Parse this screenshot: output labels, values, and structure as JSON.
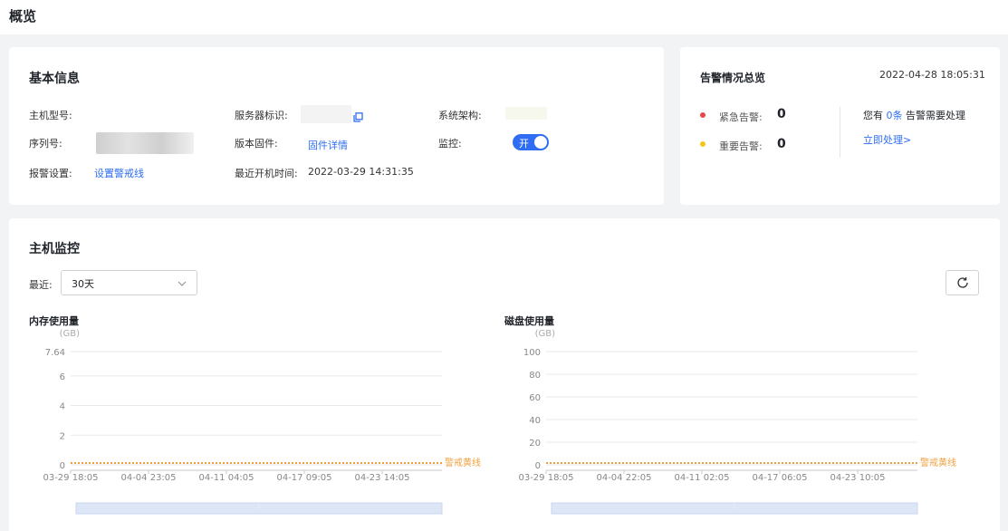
{
  "page": {
    "title": "概览"
  },
  "basic_info": {
    "title": "基本信息",
    "host_model_label": "主机型号:",
    "serial_label": "序列号:",
    "alarm_setting_label": "报警设置:",
    "alarm_setting_link": "设置警戒线",
    "server_id_label": "服务器标识:",
    "firmware_label": "版本固件:",
    "firmware_link": "固件详情",
    "last_boot_label": "最近开机时间:",
    "last_boot_value": "2022-03-29 14:31:35",
    "arch_label": "系统架构:",
    "monitor_label": "监控:",
    "monitor_toggle": "开"
  },
  "alarm_overview": {
    "title": "告警情况总览",
    "timestamp": "2022-04-28 18:05:31",
    "urgent_label": "紧急告警:",
    "urgent_count": "0",
    "important_label": "重要告警:",
    "important_count": "0",
    "pending_prefix": "您有",
    "pending_count": "0条",
    "pending_suffix": "告警需要处理",
    "handle_link": "立即处理>",
    "colors": {
      "urgent": "#e5484d",
      "important": "#f5c518",
      "link": "#2f6ef2"
    }
  },
  "host_monitor": {
    "title": "主机监控",
    "range_label": "最近:",
    "range_value": "30天"
  },
  "chart_data": [
    {
      "type": "line",
      "title": "内存使用量",
      "unit": "(GB)",
      "y_ticks": [
        "7.64",
        "6",
        "4",
        "2",
        "0"
      ],
      "ylim": [
        0,
        7.64
      ],
      "x_ticks": [
        "03-29 18:05",
        "04-04 23:05",
        "04-11 04:05",
        "04-17 09:05",
        "04-23 14:05"
      ],
      "threshold": {
        "label": "警戒黄线",
        "value": 0,
        "color": "#f0a040"
      },
      "series": [],
      "grid": true
    },
    {
      "type": "line",
      "title": "磁盘使用量",
      "unit": "(GB)",
      "y_ticks": [
        "100",
        "80",
        "60",
        "40",
        "20",
        "0"
      ],
      "ylim": [
        0,
        100
      ],
      "x_ticks": [
        "03-29 18:05",
        "04-04 22:05",
        "04-11 02:05",
        "04-17 06:05",
        "04-23 10:05"
      ],
      "threshold": {
        "label": "警戒黄线",
        "value": 0,
        "color": "#f0a040"
      },
      "series": [],
      "grid": true
    }
  ]
}
